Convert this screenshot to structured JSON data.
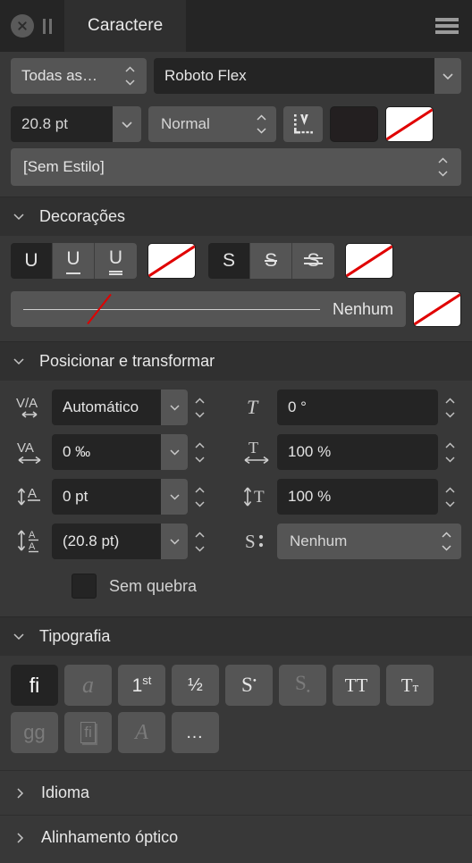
{
  "titlebar": {
    "tab_label": "Caractere",
    "close_icon": "close-circle-icon",
    "grip_icon": "drag-handle-icon",
    "menu_icon": "hamburger-menu-icon"
  },
  "font_row": {
    "filter_value": "Todas as…",
    "family_value": "Roboto Flex"
  },
  "size_row": {
    "size_value": "20.8 pt",
    "weight_value": "Normal",
    "leading_icon": "text-baseline-icon",
    "fill_swatch": "#231f20",
    "stroke_swatch": "none"
  },
  "style_row": {
    "value": "[Sem Estilo]"
  },
  "sections": {
    "decorations": {
      "title": "Decorações",
      "expanded": true,
      "underline_buttons": [
        {
          "label": "U",
          "name": "underline-none-button",
          "active": true,
          "style": "plain"
        },
        {
          "label": "U",
          "name": "underline-single-button",
          "active": false,
          "style": "single"
        },
        {
          "label": "U",
          "name": "underline-double-button",
          "active": false,
          "style": "double"
        }
      ],
      "underline_color": "none",
      "strikethrough_buttons": [
        {
          "label": "S",
          "name": "strikethrough-none-button",
          "active": true,
          "style": "plain"
        },
        {
          "label": "S",
          "name": "strikethrough-single-button",
          "active": false,
          "style": "single"
        },
        {
          "label": "S",
          "name": "strikethrough-double-button",
          "active": false,
          "style": "double"
        }
      ],
      "strikethrough_color": "none",
      "line_style_value": "Nenhum",
      "line_style_color": "none"
    },
    "position_transform": {
      "title": "Posicionar e transformar",
      "expanded": true,
      "kerning": {
        "icon": "kerning-icon",
        "value": "Automático"
      },
      "tracking": {
        "icon": "tracking-icon",
        "value": "0 ‰"
      },
      "baseline": {
        "icon": "baseline-shift-icon",
        "value": "0 pt"
      },
      "leading": {
        "icon": "leading-icon",
        "value": "(20.8 pt)"
      },
      "skew": {
        "icon": "skew-icon",
        "value": "0 °"
      },
      "horizontal_scale": {
        "icon": "horizontal-scale-icon",
        "value": "100 %"
      },
      "vertical_scale": {
        "icon": "vertical-scale-icon",
        "value": "100 %"
      },
      "position": {
        "icon": "text-position-icon",
        "value": "Nenhum"
      },
      "no_break": {
        "label": "Sem quebra",
        "checked": false
      }
    },
    "typography": {
      "title": "Tipografia",
      "expanded": true,
      "row1": [
        {
          "label": "fi",
          "name": "standard-ligatures-button",
          "state": "active"
        },
        {
          "label": "a",
          "name": "contextual-alternates-button",
          "state": "disabled"
        },
        {
          "label": "1st",
          "name": "ordinals-button",
          "state": "normal"
        },
        {
          "label": "½",
          "name": "fractions-button",
          "state": "normal"
        },
        {
          "label": "S",
          "name": "superscript-button",
          "state": "normal"
        },
        {
          "label": "S",
          "name": "subscript-button",
          "state": "disabled"
        },
        {
          "label": "TT",
          "name": "all-caps-button",
          "state": "normal"
        },
        {
          "label": "TT",
          "name": "small-caps-button",
          "state": "normal"
        }
      ],
      "row2": [
        {
          "label": "gg",
          "name": "alternate-glyphs-button",
          "state": "disabled"
        },
        {
          "label": "fi",
          "name": "discretionary-ligatures-button",
          "state": "disabled"
        },
        {
          "label": "A",
          "name": "swash-button",
          "state": "disabled"
        },
        {
          "label": "…",
          "name": "more-typography-button",
          "state": "normal"
        }
      ]
    },
    "language": {
      "title": "Idioma",
      "expanded": false
    },
    "optical_alignment": {
      "title": "Alinhamento óptico",
      "expanded": false
    }
  }
}
